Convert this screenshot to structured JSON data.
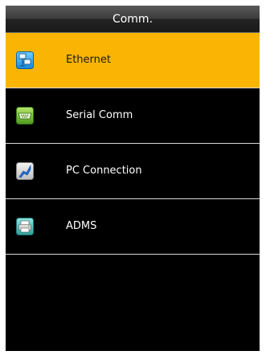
{
  "title": "Comm.",
  "menu": {
    "items": [
      {
        "label": "Ethernet",
        "icon": "ethernet-icon",
        "selected": true
      },
      {
        "label": "Serial Comm",
        "icon": "serial-port-icon",
        "selected": false
      },
      {
        "label": "PC Connection",
        "icon": "pc-connection-icon",
        "selected": false
      },
      {
        "label": "ADMS",
        "icon": "adms-printer-icon",
        "selected": false
      }
    ]
  },
  "colors": {
    "highlight": "#f9b404",
    "background": "#000000",
    "title_bar": "#3b3b3b"
  }
}
